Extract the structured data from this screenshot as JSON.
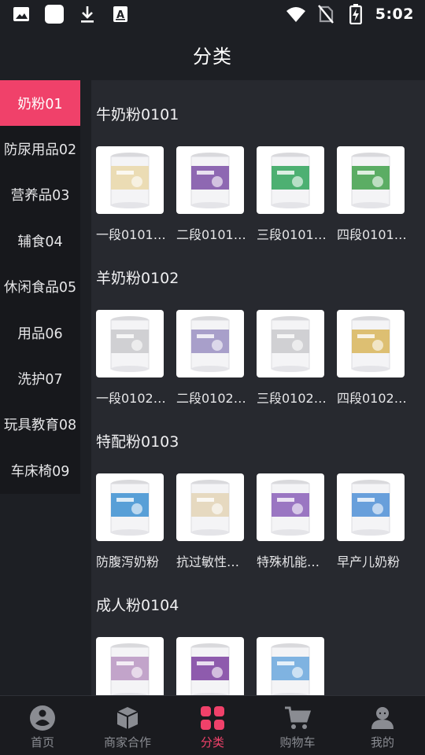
{
  "status_bar": {
    "time": "5:02",
    "left_icons": [
      "image-icon",
      "square-icon",
      "download-icon",
      "text-box-icon"
    ],
    "right_icons": [
      "wifi-icon",
      "no-sim-icon",
      "battery-charging-icon"
    ]
  },
  "header": {
    "title": "分类"
  },
  "sidebar": {
    "active_index": 0,
    "items": [
      {
        "label": "奶粉01"
      },
      {
        "label": "防尿用品02"
      },
      {
        "label": "营养品03"
      },
      {
        "label": "辅食04"
      },
      {
        "label": "休闲食品05"
      },
      {
        "label": "用品06"
      },
      {
        "label": "洗护07"
      },
      {
        "label": "玩具教育08"
      },
      {
        "label": "车床椅09"
      }
    ]
  },
  "sections": [
    {
      "title": "牛奶粉0101",
      "products": [
        {
          "name": "一段0101…",
          "color": "#e9d7a8"
        },
        {
          "name": "二段0101…",
          "color": "#7b4fa6"
        },
        {
          "name": "三段0101…",
          "color": "#2fa35a"
        },
        {
          "name": "四段0101…",
          "color": "#3fa04a"
        }
      ]
    },
    {
      "title": "羊奶粉0102",
      "products": [
        {
          "name": "一段0102…",
          "color": "#c9c9cc"
        },
        {
          "name": "二段0102…",
          "color": "#9a8fc2"
        },
        {
          "name": "三段0102…",
          "color": "#c9c9cc"
        },
        {
          "name": "四段0102…",
          "color": "#d8b55a"
        }
      ]
    },
    {
      "title": "特配粉0103",
      "products": [
        {
          "name": "防腹泻奶粉",
          "color": "#3c8fd1"
        },
        {
          "name": "抗过敏性奶粉",
          "color": "#e3d3b6"
        },
        {
          "name": "特殊机能奶粉",
          "color": "#8a5fb8"
        },
        {
          "name": "早产儿奶粉",
          "color": "#4f8fd6"
        }
      ]
    },
    {
      "title": "成人粉0104",
      "products": [
        {
          "name": "",
          "color": "#b995c2"
        },
        {
          "name": "",
          "color": "#7b3fa0"
        },
        {
          "name": "",
          "color": "#6aa7dd"
        }
      ]
    }
  ],
  "tabbar": {
    "active_index": 2,
    "accent": "#f0416a",
    "items": [
      {
        "label": "首页",
        "icon": "home-icon"
      },
      {
        "label": "商家合作",
        "icon": "box-icon"
      },
      {
        "label": "分类",
        "icon": "category-grid-icon"
      },
      {
        "label": "购物车",
        "icon": "cart-icon"
      },
      {
        "label": "我的",
        "icon": "profile-icon"
      }
    ]
  }
}
